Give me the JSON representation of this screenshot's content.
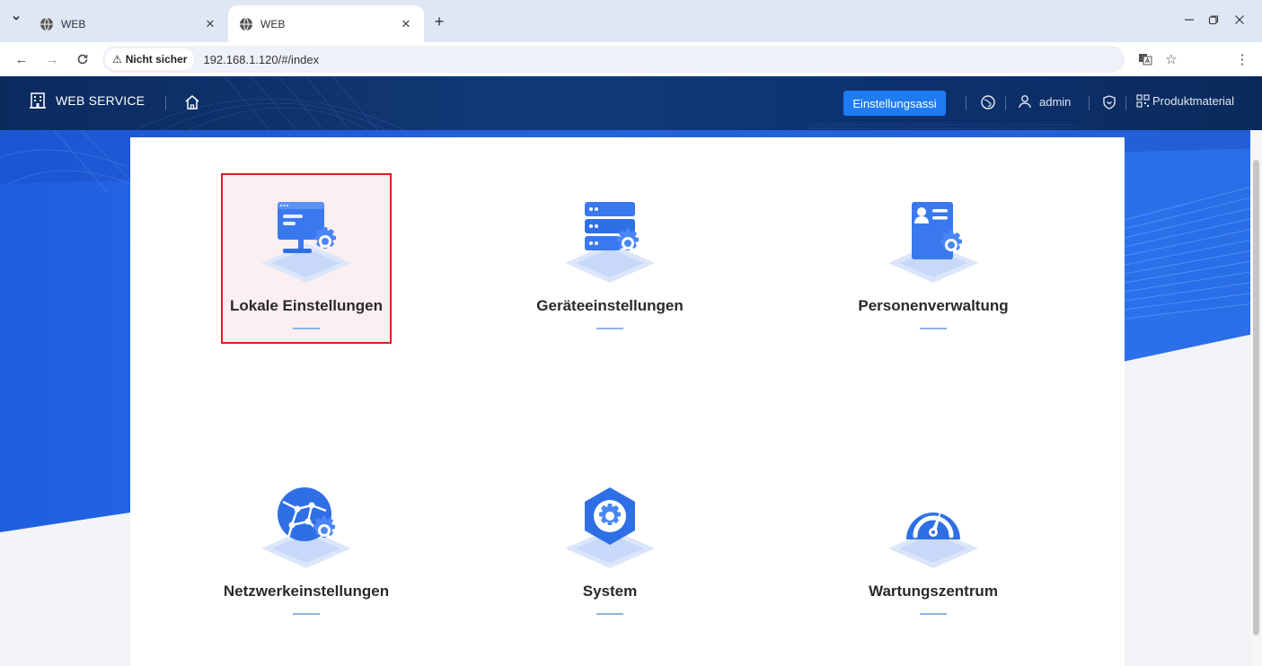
{
  "browser": {
    "tabs": [
      {
        "title": "WEB",
        "active": false
      },
      {
        "title": "WEB",
        "active": true
      }
    ],
    "security_label": "Nicht sicher",
    "url": "192.168.1.120/#/index"
  },
  "header": {
    "brand": "WEB SERVICE",
    "wizard_label": "Einstellungsassi",
    "user": "admin",
    "material": "Produktmaterial"
  },
  "tiles": [
    {
      "label": "Lokale Einstellungen",
      "icon": "monitor-gear-icon",
      "selected": true
    },
    {
      "label": "Geräteeinstellungen",
      "icon": "server-gear-icon",
      "selected": false
    },
    {
      "label": "Personenverwaltung",
      "icon": "person-card-gear-icon",
      "selected": false
    },
    {
      "label": "Netzwerkeinstellungen",
      "icon": "globe-gear-icon",
      "selected": false
    },
    {
      "label": "System",
      "icon": "hexagon-gear-icon",
      "selected": false
    },
    {
      "label": "Wartungszentrum",
      "icon": "speedometer-icon",
      "selected": false
    }
  ],
  "colors": {
    "accent": "#1e7bf2",
    "header_bg": "#0b2b5f",
    "selection_border": "#d91f26",
    "icon_blue": "#2f6fe6"
  }
}
